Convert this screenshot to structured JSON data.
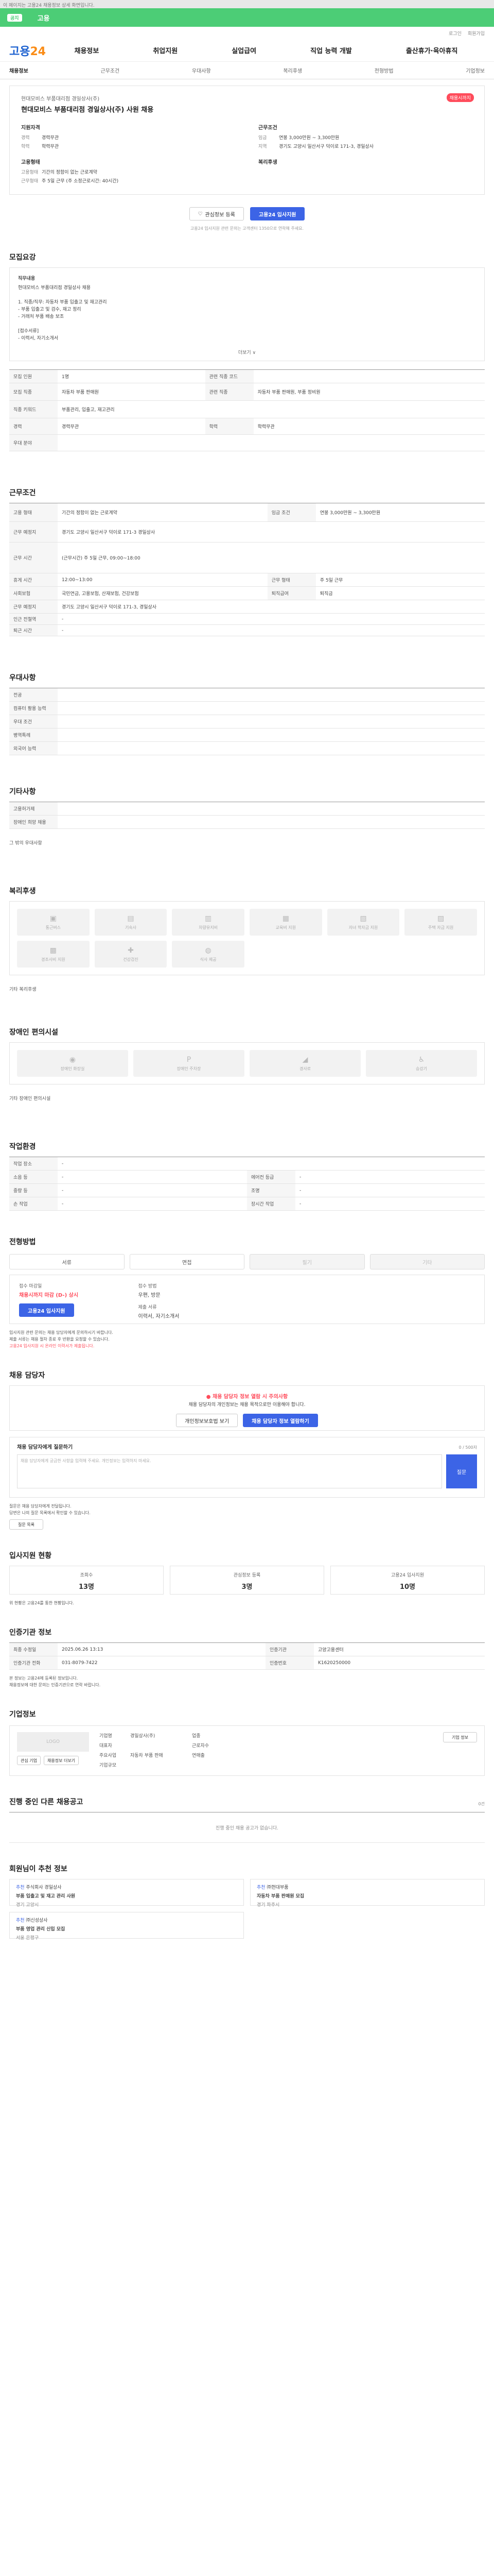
{
  "topbar": {
    "text": "이 페이지는 고용24 채용정보 상세 화면입니다."
  },
  "notice": {
    "badge": "공지",
    "text": "고용"
  },
  "util": {
    "items": [
      "로그인",
      "회원가입"
    ]
  },
  "header": {
    "logo_a": "고용",
    "logo_b": "24",
    "menu": [
      "채용정보",
      "취업지원",
      "실업급여",
      "직업 능력 개발",
      "출산휴가·육아휴직"
    ]
  },
  "subnav": {
    "items": [
      "채용정보",
      "근무조건",
      "우대사항",
      "복리후생",
      "전형방법",
      "기업정보"
    ]
  },
  "job": {
    "company": "현대모비스 부품대리점 경일상사(주)",
    "title": "현대모비스 부품대리점 경일상사(주) 사원 채용",
    "dday": "채용시까지",
    "left_head": "지원자격",
    "left": [
      {
        "k": "경력",
        "v": "경력무관"
      },
      {
        "k": "학력",
        "v": "학력무관"
      }
    ],
    "left_head2": "고용형태",
    "left2": [
      {
        "k": "고용형태",
        "v": "기간의 정함이 없는 근로계약"
      },
      {
        "k": "근무형태",
        "v": "주 5일 근무 (주 소정근로시간: 40시간)"
      }
    ],
    "right_head": "근무조건",
    "right": [
      {
        "k": "임금",
        "v": "연봉 3,000만원 ~ 3,300만원"
      },
      {
        "k": "지역",
        "v": "경기도 고양시 일산서구 덕이로 171-3, 경일상사"
      }
    ],
    "right_head2": "복리후생",
    "right2": []
  },
  "actions": {
    "scrap": "관심정보 등록",
    "apply": "고용24 입사지원"
  },
  "notice2": "고용24 입사지원 관련 문의는 고객센터 1350으로 연락해 주세요.",
  "summary": {
    "title": "모집요강",
    "head": "직무내용",
    "lines": [
      "현대모비스 부품대리점 경일상사 채용",
      "",
      "1. 직종/직무: 자동차 부품 입출고 및 재고관리",
      "- 부품 입출고 및 검수, 재고 정리",
      "- 거래처 부품 배송 보조",
      "",
      "[접수서류]",
      "- 이력서, 자기소개서",
      "",
      "문의: 채용 담당자"
    ],
    "more": "더보기 ∨"
  },
  "recruit_rows": [
    [
      "모집 인원",
      "1명",
      "관련 직종 코드",
      ""
    ],
    [
      "모집 직종",
      "자동차 부품 판매원",
      "관련 직종",
      "자동차 부품 판매원, 부품 정비원"
    ],
    [
      "직종 키워드",
      "부품관리, 입출고, 재고관리",
      "",
      ""
    ],
    [
      "경력",
      "경력무관",
      "학력",
      "학력무관"
    ],
    [
      "우대 분야",
      "",
      "",
      ""
    ]
  ],
  "cond": {
    "title": "근무조건",
    "rows": [
      [
        "고용 형태",
        "기간의 정함이 없는 근로계약",
        "임금 조건",
        "연봉 3,000만원 ~ 3,300만원"
      ],
      [
        "근무 예정지",
        "경기도 고양시 일산서구 덕이로 171-3 경일상사",
        "",
        ""
      ],
      [
        "근무 시간",
        "(근무시간) 주 5일 근무, 09:00~18:00",
        "",
        ""
      ],
      [
        "휴게 시간",
        "12:00~13:00",
        "근무 형태",
        "주 5일 근무"
      ],
      [
        "사회보험",
        "국민연금, 고용보험, 산재보험, 건강보험",
        "퇴직급여",
        "퇴직금"
      ],
      [
        "근무 예정지",
        "경기도 고양시 일산서구 덕이로 171-3, 경일상사",
        "",
        ""
      ],
      [
        "인근 전철역",
        "-",
        "",
        ""
      ],
      [
        "퇴근 시간",
        "-",
        "",
        ""
      ]
    ]
  },
  "pref": {
    "title": "우대사항",
    "rows": [
      [
        "전공",
        ""
      ],
      [
        "컴퓨터 활용 능력",
        ""
      ],
      [
        "우대 조건",
        ""
      ],
      [
        "병역특례",
        "",
        ""
      ],
      [
        "외국어 능력",
        ""
      ]
    ]
  },
  "etc": {
    "title": "기타사항",
    "rows": [
      [
        "고용허가제",
        ""
      ],
      [
        "장애인 희망 채용",
        "",
        ""
      ]
    ],
    "extra": "그 밖의 우대사항"
  },
  "welfare": {
    "title": "복리후생",
    "items": [
      "통근버스",
      "기숙사",
      "차량유지비",
      "교육비 지원",
      "자녀 학자금 지원",
      "주택 자금 지원",
      "경조사비 지원",
      "건강검진",
      "식사 제공"
    ],
    "etc": "기타 복리후생"
  },
  "disability": {
    "title": "장애인 편의시설",
    "items": [
      "장애인 화장실",
      "장애인 주차장",
      "경사로",
      "승강기"
    ],
    "etc": "기타 장애인 편의시설"
  },
  "env": {
    "title": "작업환경",
    "rows": [
      [
        "작업 장소",
        "-",
        "",
        ""
      ],
      [
        "소음 등",
        "-",
        "에어컨 등급",
        "-"
      ],
      [
        "중량 등",
        "-",
        "조명",
        "-"
      ],
      [
        "손 작업",
        "-",
        "장시간 작업",
        "-"
      ]
    ]
  },
  "process": {
    "title": "전형방법",
    "steps": [
      "서류",
      "면접",
      "필기",
      "기타"
    ],
    "apply_lb": "접수 마감일",
    "apply_val": "채용시까지 마감 (D-) 상시",
    "way_lb": "접수 방법",
    "way_val": "우편, 방문",
    "doc_lb": "제출 서류",
    "doc_val": "이력서, 자기소개서",
    "apply_btn": "고용24 입사지원",
    "bullets": [
      "입사지원 관련 문의는 채용 담당자에게 문의하시기 바랍니다.",
      "제출 서류는 채용 절차 종료 후 반환을 요청할 수 있습니다.",
      "고용24 입사지원 시 온라인 이력서가 제출됩니다."
    ]
  },
  "contact": {
    "title": "채용 담당자",
    "alert_t": "채용 담당자 정보 열람 시 주의사항",
    "alert_s": "채용 담당자의 개인정보는 채용 목적으로만 이용해야 합니다.",
    "btn1": "개인정보보호법 보기",
    "btn2": "채용 담당자 정보 열람하기"
  },
  "qna": {
    "title": "채용 담당자에게 질문하기",
    "count": "0 / 500자",
    "placeholder": "채용 담당자에게 궁금한 사항을 입력해 주세요. 개인정보는 입력하지 마세요.",
    "btn": "질문",
    "notes": [
      "질문은 채용 담당자에게 전달됩니다.",
      "답변은 나의 질문 목록에서 확인할 수 있습니다."
    ],
    "list_btn": "질문 목록"
  },
  "status": {
    "title": "입사지원 현황",
    "items": [
      {
        "lb": "조회수",
        "v": "13명"
      },
      {
        "lb": "관심정보 등록",
        "v": "3명"
      },
      {
        "lb": "고용24 입사지원",
        "v": "10명"
      }
    ],
    "note": "위 현황은 고용24를 통한 현황입니다."
  },
  "agency": {
    "title": "인증기관 정보",
    "rows": [
      [
        "최종 수정일",
        "2025.06.26 13:13",
        "인증기관",
        "고양고용센터"
      ],
      [
        "인증기관 전화",
        "031-8079-7422",
        "인증번호",
        "K1620250000"
      ]
    ],
    "notes": [
      "본 정보는 고용24에 등록된 정보입니다.",
      "채용정보에 대한 문의는 인증기관으로 연락 바랍니다."
    ]
  },
  "company": {
    "title": "기업정보",
    "logo": "LOGO",
    "rows": [
      [
        "기업명",
        "경일상사(주)",
        "업종",
        ""
      ],
      [
        "대표자",
        "",
        "근로자수",
        ""
      ],
      [
        "주요사업",
        "자동차 부품 판매",
        "연매출",
        ""
      ],
      [
        "기업규모",
        "",
        "",
        ""
      ]
    ],
    "btn1": "관심 기업",
    "btn2": "채용정보 더보기",
    "btn3": "기업 정보"
  },
  "other": {
    "title": "진행 중인 다른 채용공고",
    "empty": "진행 중인 채용 공고가 없습니다.",
    "count": "0건"
  },
  "rec": {
    "title": "회원님이 추천 정보",
    "items": [
      {
        "tag": "추천",
        "name": "주식회사 경일상사",
        "t": "부품 입출고 및 재고 관리 사원",
        "m": "경기 고양시"
      },
      {
        "tag": "추천",
        "name": "㈜현대부품",
        "t": "자동차 부품 판매원 모집",
        "m": "경기 파주시"
      },
      {
        "tag": "추천",
        "name": "㈜신성상사",
        "t": "부품 영업 관리 신입 모집",
        "m": "서울 은평구"
      }
    ]
  }
}
